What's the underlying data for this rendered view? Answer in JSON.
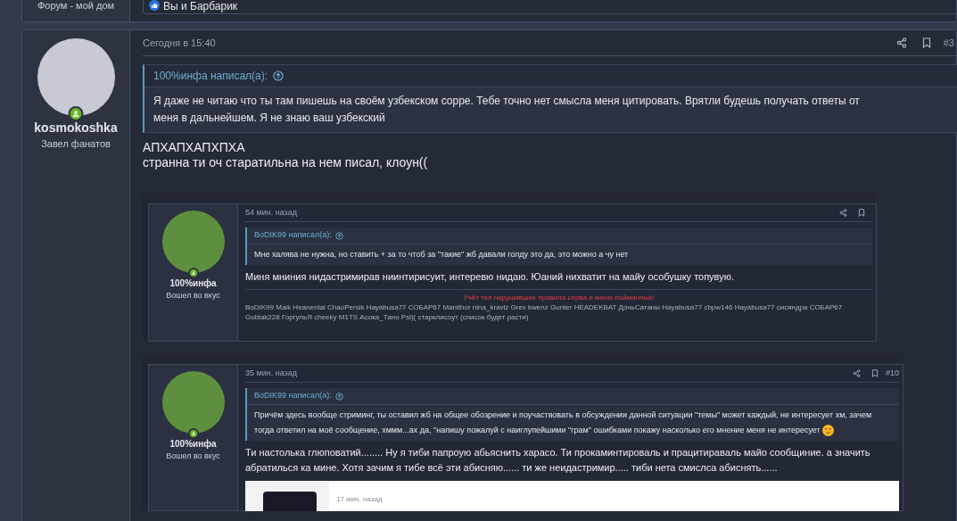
{
  "previous_post": {
    "user_title": "Форум - мой дом",
    "reactions": "Вы и Барбарик"
  },
  "post": {
    "author": {
      "name": "kosmokoshka",
      "title": "Завел фанатов",
      "online": true
    },
    "time": "Сегодня в 15:40",
    "number": "#3",
    "quote": {
      "author": "100%инфа написал(а):",
      "text": "Я даже не читаю что ты там пишешь на своём узбекском сорре. Тебе точно нет смысла меня цитировать. Врятли будешь получать ответы от меня в дальнейшем. Я не знаю ваш узбекский"
    },
    "body": [
      "АПХАПХАПХПХА",
      "странна ти оч старатильна на нем писал, клоун(("
    ],
    "attachments": [
      {
        "author": {
          "name": "100%инфа",
          "title": "Вошел во вкус",
          "online": true
        },
        "time": "54 мин. назад",
        "quote": {
          "author": "BoDIK99 написал(а):",
          "text": "Мне халява не нужна, но ставить + за то чтоб за \"такие\" жб давали голду это да, это можно а чу нет",
          "trailing_emoji": false
        },
        "body": "Миня мниния нидастримирав ниинтирисуит, интеревю нидаю. Юаний нихватит на майу особушку топувую.",
        "signature": {
          "heading": "Учёт тел нарушивших правила сервa и мною пойманных!",
          "text": "BoDIK99 Maik Heanental ChaoPersik Hayabusa77 СОБАР67 Mantihor nina_kraviz Grex kwenz Gunter HEADEKBAT ДочьСатаны Hayabusa77 cbpw146 Hayabusa77 сисяндра СОБАР67 Goblak228 ГоргульЯ cheeky M1TS Асока_Тано Psi)( старклисоут (список будет расти)"
        }
      },
      {
        "author": {
          "name": "100%инфа",
          "title": "Вошел во вкус",
          "online": true
        },
        "time": "35 мин. назад",
        "number": "#10",
        "quote": {
          "author": "BoDIK99 написал(а):",
          "text": "Причём здесь вообще стриминг, ты оставил жб на общее обозрение и поучаствовать в обсуждении данной ситуации \"темы\" может каждый, не интересует хм, зачем тогда ответил на моё сообщение, хммм...ах да, \"напишу пожалуй с наиглупейшими \"грам\" ошибками покажу насколько его мнение меня не интересует",
          "trailing_emoji": true
        },
        "body": "Ти настолька глюповатий........ Ну я тиби папроую абьяснить харасо. Ти прокаминтироваль и працитираваль майо сообщиние. а значить абратилься ка мине. Хотя зачим я тибе всё эти абисняю...... ти же неидастримир..... тиби нета смислса абиснять......",
        "nested_screenshot": {
          "time": "17 мин. назад"
        }
      }
    ]
  }
}
